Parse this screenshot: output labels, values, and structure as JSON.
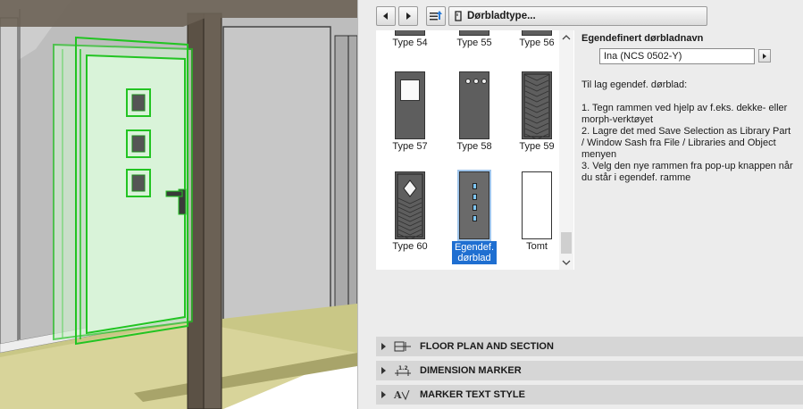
{
  "toolbar": {
    "title": "Dørbladtype...",
    "prev_icon": "chevron-left-icon",
    "next_icon": "chevron-right-icon",
    "settings_icon": "settings-list-icon"
  },
  "gallery": {
    "items": [
      {
        "label": "Type 54",
        "style": "partial"
      },
      {
        "label": "Type 55",
        "style": "partial"
      },
      {
        "label": "Type 56",
        "style": "partial"
      },
      {
        "label": "Type 57",
        "style": "window"
      },
      {
        "label": "Type 58",
        "style": "dots"
      },
      {
        "label": "Type 59",
        "style": "herringbone"
      },
      {
        "label": "Type 60",
        "style": "diamond"
      },
      {
        "label": "Egendef.\ndørblad",
        "style": "custom",
        "selected": true
      },
      {
        "label": "Tomt",
        "style": "empty"
      }
    ]
  },
  "custom": {
    "label": "Egendefinert dørbladnavn",
    "field_value": "Ina (NCS 0502-Y)",
    "instructions": "Til lag egendef. dørblad:\n\n1. Tegn rammen ved hjelp av f.eks. dekke- eller morph-verktøyet\n2. Lagre det med Save Selection as Library Part / Window Sash fra File / Libraries and Object menyen\n3. Velg den nye rammen fra pop-up knappen når du står i egendef. ramme"
  },
  "sections": [
    {
      "label": "FLOOR PLAN AND SECTION",
      "icon": "floor-plan-section-icon"
    },
    {
      "label": "DIMENSION MARKER",
      "icon": "dimension-marker-icon"
    },
    {
      "label": "MARKER TEXT STYLE",
      "icon": "marker-text-style-icon"
    }
  ],
  "colors": {
    "selection": "#1f6fd1",
    "highlight_green": "#22c422",
    "door_dark": "#5e5e5e",
    "floor": "#c9c786"
  }
}
